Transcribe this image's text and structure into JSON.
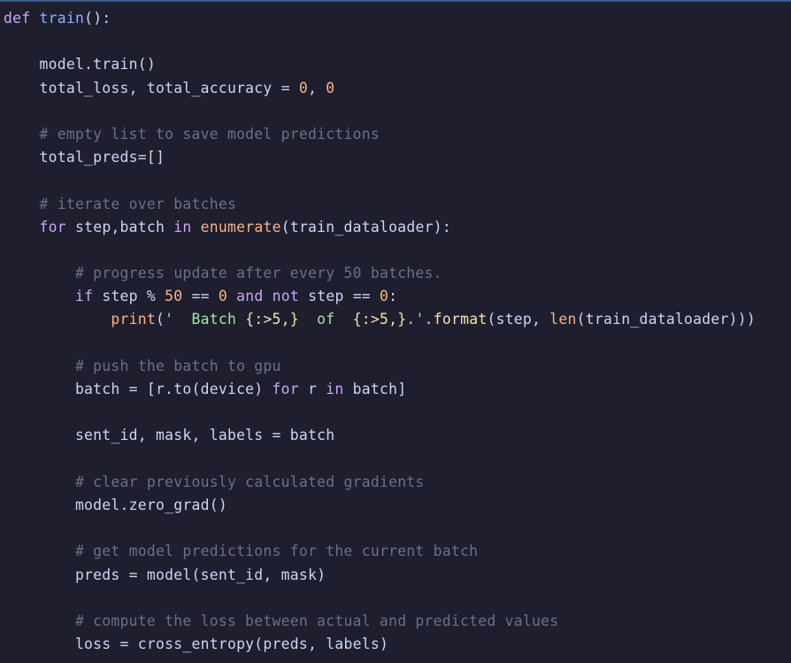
{
  "editor": {
    "language": "python",
    "theme_colors": {
      "background": "#1e1e2e",
      "keyword": "#cba6f7",
      "function": "#89b4fa",
      "number": "#fab387",
      "string": "#a6e3a1",
      "comment": "#6c7086",
      "text": "#cdd6f4"
    },
    "lines": [
      [
        {
          "t": "keyword",
          "v": "def"
        },
        {
          "t": "plain",
          "v": " "
        },
        {
          "t": "func",
          "v": "train"
        },
        {
          "t": "plain",
          "v": "():"
        }
      ],
      [],
      [
        {
          "t": "plain",
          "v": "    model.train()"
        }
      ],
      [
        {
          "t": "plain",
          "v": "    total_loss, total_accuracy = "
        },
        {
          "t": "number",
          "v": "0"
        },
        {
          "t": "plain",
          "v": ", "
        },
        {
          "t": "number",
          "v": "0"
        }
      ],
      [],
      [
        {
          "t": "comment",
          "v": "    # empty list to save model predictions"
        }
      ],
      [
        {
          "t": "plain",
          "v": "    total_preds=[]"
        }
      ],
      [],
      [
        {
          "t": "comment",
          "v": "    # iterate over batches"
        }
      ],
      [
        {
          "t": "plain",
          "v": "    "
        },
        {
          "t": "keyword",
          "v": "for"
        },
        {
          "t": "plain",
          "v": " step,batch "
        },
        {
          "t": "keyword",
          "v": "in"
        },
        {
          "t": "plain",
          "v": " "
        },
        {
          "t": "builtin",
          "v": "enumerate"
        },
        {
          "t": "plain",
          "v": "(train_dataloader):"
        }
      ],
      [],
      [
        {
          "t": "comment",
          "v": "        # progress update after every 50 batches."
        }
      ],
      [
        {
          "t": "plain",
          "v": "        "
        },
        {
          "t": "keyword",
          "v": "if"
        },
        {
          "t": "plain",
          "v": " step % "
        },
        {
          "t": "number",
          "v": "50"
        },
        {
          "t": "plain",
          "v": " == "
        },
        {
          "t": "number",
          "v": "0"
        },
        {
          "t": "plain",
          "v": " "
        },
        {
          "t": "keyword",
          "v": "and"
        },
        {
          "t": "plain",
          "v": " "
        },
        {
          "t": "keyword",
          "v": "not"
        },
        {
          "t": "plain",
          "v": " step == "
        },
        {
          "t": "number",
          "v": "0"
        },
        {
          "t": "plain",
          "v": ":"
        }
      ],
      [
        {
          "t": "plain",
          "v": "            "
        },
        {
          "t": "builtin",
          "v": "print"
        },
        {
          "t": "plain",
          "v": "("
        },
        {
          "t": "string",
          "v": "'  Batch "
        },
        {
          "t": "brace",
          "v": "{:>5,}"
        },
        {
          "t": "string",
          "v": "  of  "
        },
        {
          "t": "brace",
          "v": "{:>5,}"
        },
        {
          "t": "string",
          "v": ".'"
        },
        {
          "t": "plain",
          "v": "."
        },
        {
          "t": "brace",
          "v": "format"
        },
        {
          "t": "plain",
          "v": "(step, "
        },
        {
          "t": "builtin",
          "v": "len"
        },
        {
          "t": "plain",
          "v": "(train_dataloader)))"
        }
      ],
      [],
      [
        {
          "t": "comment",
          "v": "        # push the batch to gpu"
        }
      ],
      [
        {
          "t": "plain",
          "v": "        batch = [r.to(device) "
        },
        {
          "t": "keyword",
          "v": "for"
        },
        {
          "t": "plain",
          "v": " r "
        },
        {
          "t": "keyword",
          "v": "in"
        },
        {
          "t": "plain",
          "v": " batch]"
        }
      ],
      [],
      [
        {
          "t": "plain",
          "v": "        sent_id, mask, labels = batch"
        }
      ],
      [],
      [
        {
          "t": "comment",
          "v": "        # clear previously calculated gradients"
        }
      ],
      [
        {
          "t": "plain",
          "v": "        model.zero_grad()"
        }
      ],
      [],
      [
        {
          "t": "comment",
          "v": "        # get model predictions for the current batch"
        }
      ],
      [
        {
          "t": "plain",
          "v": "        preds = model(sent_id, mask)"
        }
      ],
      [],
      [
        {
          "t": "comment",
          "v": "        # compute the loss between actual and predicted values"
        }
      ],
      [
        {
          "t": "plain",
          "v": "        loss = cross_entropy(preds, labels)"
        }
      ]
    ]
  }
}
